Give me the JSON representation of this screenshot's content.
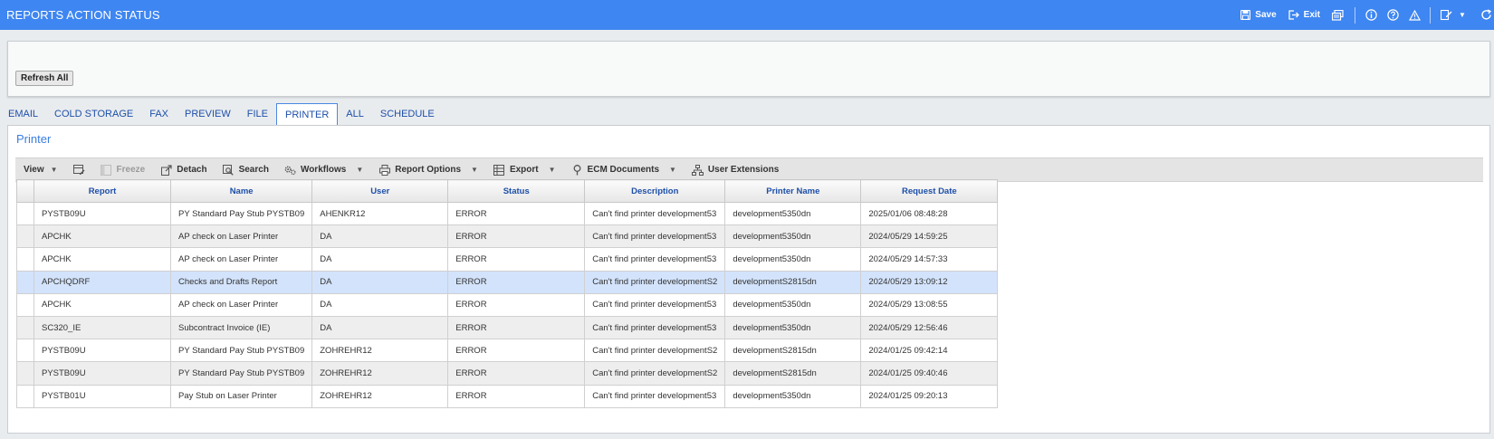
{
  "window": {
    "title": "REPORTS ACTION STATUS",
    "save_label": "Save",
    "exit_label": "Exit",
    "brand_color": "#3e86f1"
  },
  "topbox": {
    "refresh_label": "Refresh All"
  },
  "tabs": [
    {
      "label": "EMAIL",
      "active": false
    },
    {
      "label": "COLD STORAGE",
      "active": false
    },
    {
      "label": "FAX",
      "active": false
    },
    {
      "label": "PREVIEW",
      "active": false
    },
    {
      "label": "FILE",
      "active": false
    },
    {
      "label": "PRINTER",
      "active": true
    },
    {
      "label": "ALL",
      "active": false
    },
    {
      "label": "SCHEDULE",
      "active": false
    }
  ],
  "panel": {
    "title": "Printer",
    "toolbar": {
      "view": "View",
      "freeze": "Freeze",
      "detach": "Detach",
      "search": "Search",
      "workflows": "Workflows",
      "report_options": "Report Options",
      "export": "Export",
      "ecm_documents": "ECM Documents",
      "user_extensions": "User Extensions"
    }
  },
  "grid": {
    "columns": [
      "Report",
      "Name",
      "User",
      "Status",
      "Description",
      "Printer Name",
      "Request Date"
    ],
    "rows": [
      [
        "PYSTB09U",
        "PY Standard Pay Stub PYSTB09",
        "AHENKR12",
        "ERROR",
        "Can't find printer development53",
        "development5350dn",
        "2025/01/06 08:48:28"
      ],
      [
        "APCHK",
        "AP check on Laser Printer",
        "DA",
        "ERROR",
        "Can't find printer development53",
        "development5350dn",
        "2024/05/29 14:59:25"
      ],
      [
        "APCHK",
        "AP check on Laser Printer",
        "DA",
        "ERROR",
        "Can't find printer development53",
        "development5350dn",
        "2024/05/29 14:57:33"
      ],
      [
        "APCHQDRF",
        "Checks and Drafts Report",
        "DA",
        "ERROR",
        "Can't find printer developmentS2",
        "developmentS2815dn",
        "2024/05/29 13:09:12"
      ],
      [
        "APCHK",
        "AP check on Laser Printer",
        "DA",
        "ERROR",
        "Can't find printer development53",
        "development5350dn",
        "2024/05/29 13:08:55"
      ],
      [
        "SC320_IE",
        "Subcontract Invoice (IE)",
        "DA",
        "ERROR",
        "Can't find printer development53",
        "development5350dn",
        "2024/05/29 12:56:46"
      ],
      [
        "PYSTB09U",
        "PY Standard Pay Stub PYSTB09",
        "ZOHREHR12",
        "ERROR",
        "Can't find printer developmentS2",
        "developmentS2815dn",
        "2024/01/25 09:42:14"
      ],
      [
        "PYSTB09U",
        "PY Standard Pay Stub PYSTB09",
        "ZOHREHR12",
        "ERROR",
        "Can't find printer developmentS2",
        "developmentS2815dn",
        "2024/01/25 09:40:46"
      ],
      [
        "PYSTB01U",
        "Pay Stub on Laser Printer",
        "ZOHREHR12",
        "ERROR",
        "Can't find printer development53",
        "development5350dn",
        "2024/01/25 09:20:13"
      ]
    ],
    "highlighted_row": 3
  }
}
